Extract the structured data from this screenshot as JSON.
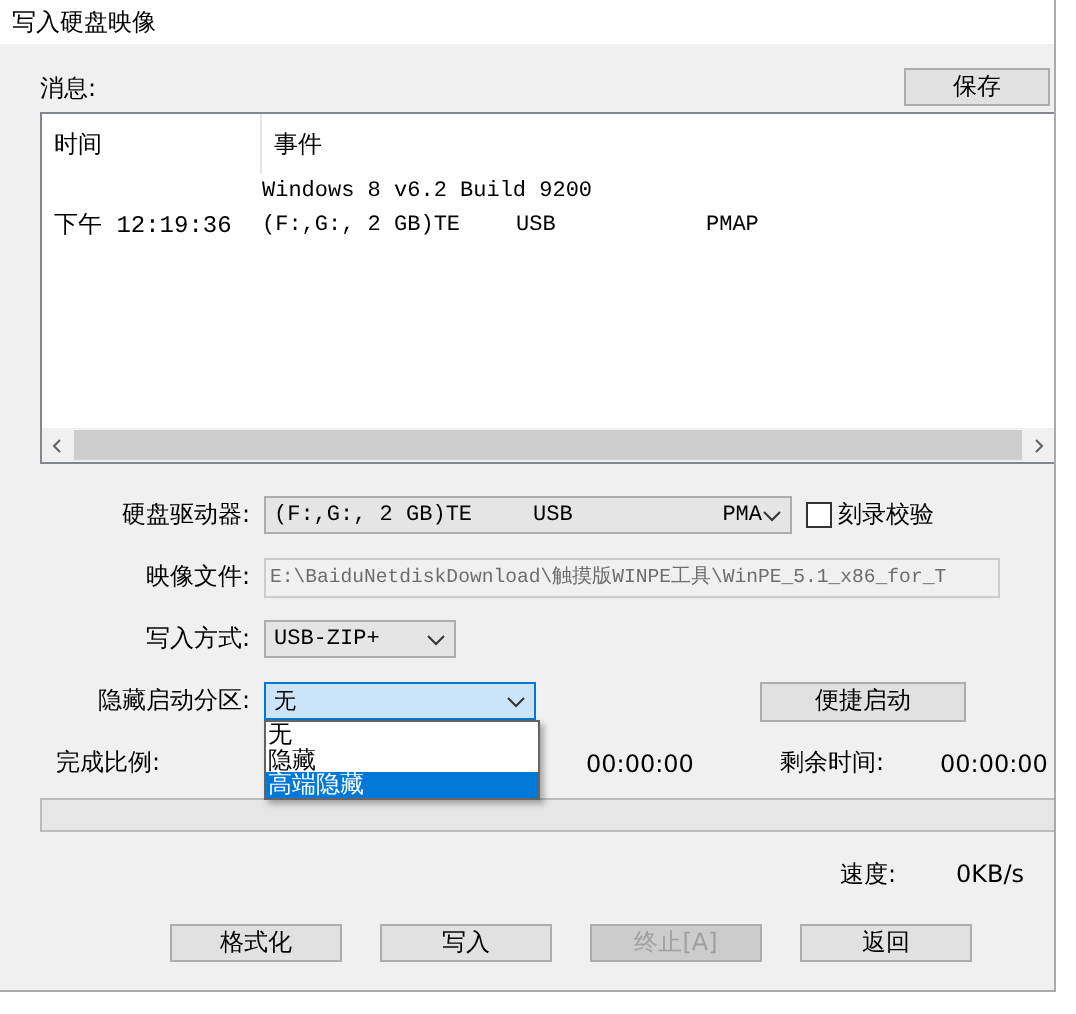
{
  "window": {
    "title": "写入硬盘映像"
  },
  "messages": {
    "label": "消息:",
    "save_button": "保存",
    "columns": [
      "时间",
      "事件"
    ],
    "rows": [
      {
        "event": [
          "Windows 8 v6.2 Build 9200"
        ]
      },
      {
        "time": "下午 12:19:36",
        "event": [
          "(F:,G:, 2 GB)TE",
          "USB",
          "PMAP"
        ]
      }
    ]
  },
  "form": [
    {
      "kind": "combo",
      "label": "硬盘驱动器:",
      "parts": [
        "(F:,G:, 2 GB)TE",
        "USB",
        "PMA"
      ],
      "extra": {
        "kind": "checkbox",
        "label": "刻录校验",
        "checked": false
      }
    },
    {
      "kind": "text",
      "label": "映像文件:",
      "value": "E:\\BaiduNetdiskDownload\\触摸版WINPE工具\\WinPE_5.1_x86_for_T"
    },
    {
      "kind": "combo",
      "label": "写入方式:",
      "parts": [
        "USB-ZIP+"
      ],
      "expanded": false
    },
    {
      "kind": "combo",
      "label": "隐藏启动分区:",
      "parts": [
        "无"
      ],
      "expanded": true,
      "extra": {
        "kind": "button",
        "label": "便捷启动"
      },
      "options": [
        {
          "label": "无",
          "selected": false
        },
        {
          "label": "隐藏",
          "selected": false
        },
        {
          "label": "高端隐藏",
          "selected": true
        }
      ]
    }
  ],
  "progress": {
    "label": "完成比例:",
    "elapsed": "00:00:00",
    "remaining_label": "剩余时间:",
    "remaining": "00:00:00",
    "level": 0,
    "speed_label": "速度:",
    "speed": "0KB/s"
  },
  "buttons": [
    {
      "label": "格式化",
      "disabled": false
    },
    {
      "label": "写入",
      "disabled": false
    },
    {
      "label": "终止[A]",
      "disabled": true
    },
    {
      "label": "返回",
      "disabled": false
    }
  ]
}
